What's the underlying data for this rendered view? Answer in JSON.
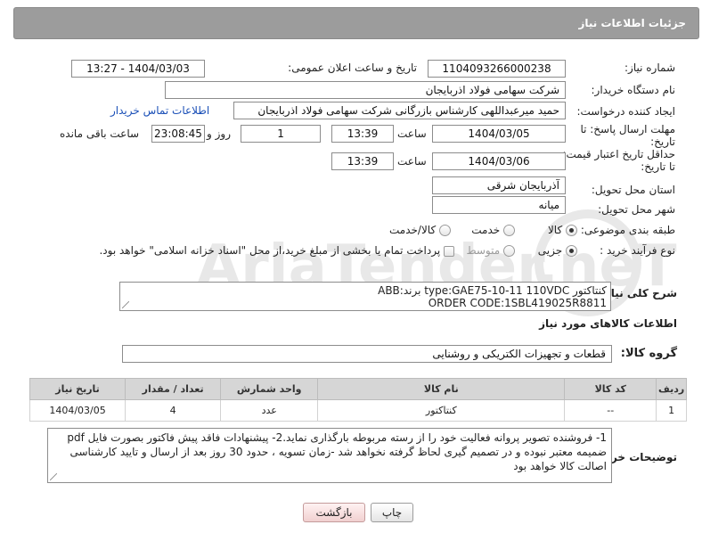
{
  "header": {
    "title": "جزئیات اطلاعات نیاز"
  },
  "form": {
    "need_number": {
      "label": "شماره نیاز:",
      "value": "1104093266000238"
    },
    "announce": {
      "label": "تاریخ و ساعت اعلان عمومی:",
      "value": "1404/03/03 - 13:27"
    },
    "buyer_org": {
      "label": "نام دستگاه خریدار:",
      "value": "شرکت سهامی فولاد اذربایجان"
    },
    "requester": {
      "label": "ایجاد کننده درخواست:",
      "value": "حمید میرعبداللهی کارشناس بازرگانی شرکت سهامی فولاد اذربایجان",
      "contact_link": "اطلاعات تماس خریدار"
    },
    "deadline": {
      "label": "مهلت ارسال پاسخ: تا تاریخ:",
      "date": "1404/03/05",
      "time_label": "ساعت",
      "time": "13:39",
      "days": "1",
      "days_label": "روز و",
      "remaining": "23:08:45",
      "remaining_label": "ساعت باقی مانده"
    },
    "price_validity": {
      "label": "حداقل تاریخ اعتبار قیمت: تا تاریخ:",
      "date": "1404/03/06",
      "time_label": "ساعت",
      "time": "13:39"
    },
    "province": {
      "label": "استان محل تحویل:",
      "value": "آذربایجان شرقی"
    },
    "city": {
      "label": "شهر محل تحویل:",
      "value": "میانه"
    },
    "category": {
      "label": "طبقه بندی موضوعی:",
      "options": [
        "کالا",
        "خدمت",
        "کالا/خدمت"
      ],
      "selected": "کالا"
    },
    "process": {
      "label": "نوع فرآیند خرید :",
      "options": [
        "جزیی",
        "متوسط"
      ],
      "selected": "جزیی",
      "payment_note": "پرداخت تمام یا بخشی از مبلغ خرید،از محل \"اسناد خزانه اسلامی\" خواهد بود."
    }
  },
  "description": {
    "label": "شرح کلی نیاز:",
    "line1": "کنتاکتور type:GAE75-10-11  110VDC برند:ABB",
    "line2": "ORDER CODE:1SBL419025R8811"
  },
  "goods_info": {
    "title": "اطلاعات کالاهای مورد نیاز",
    "group_label": "گروه کالا:",
    "group_value": "قطعات و تجهیزات الکتریکی و روشنایی"
  },
  "table": {
    "headers": [
      "ردیف",
      "کد کالا",
      "نام کالا",
      "واحد شمارش",
      "تعداد / مقدار",
      "تاریخ نیاز"
    ],
    "rows": [
      {
        "index": "1",
        "code": "--",
        "name": "کنتاکتور",
        "unit": "عدد",
        "qty": "4",
        "date": "1404/03/05"
      }
    ]
  },
  "buyer_notes": {
    "label": "توضیحات خریدار:",
    "text": "1- فروشنده تصویر پروانه فعالیت خود را از رسته مربوطه بارگذاری نماید.2- پیشنهادات فاقد پیش فاکتور بصورت فایل pdf ضمیمه معتبر نبوده و در تصمیم گیری لحاظ گرفته نخواهد شد -زمان تسویه ، حدود 30 روز بعد از ارسال و تایید کارشناسی اصالت کالا خواهد بود"
  },
  "buttons": {
    "print": "چاپ",
    "back": "بازگشت"
  },
  "watermark": {
    "text": "AriaTender.neT"
  }
}
